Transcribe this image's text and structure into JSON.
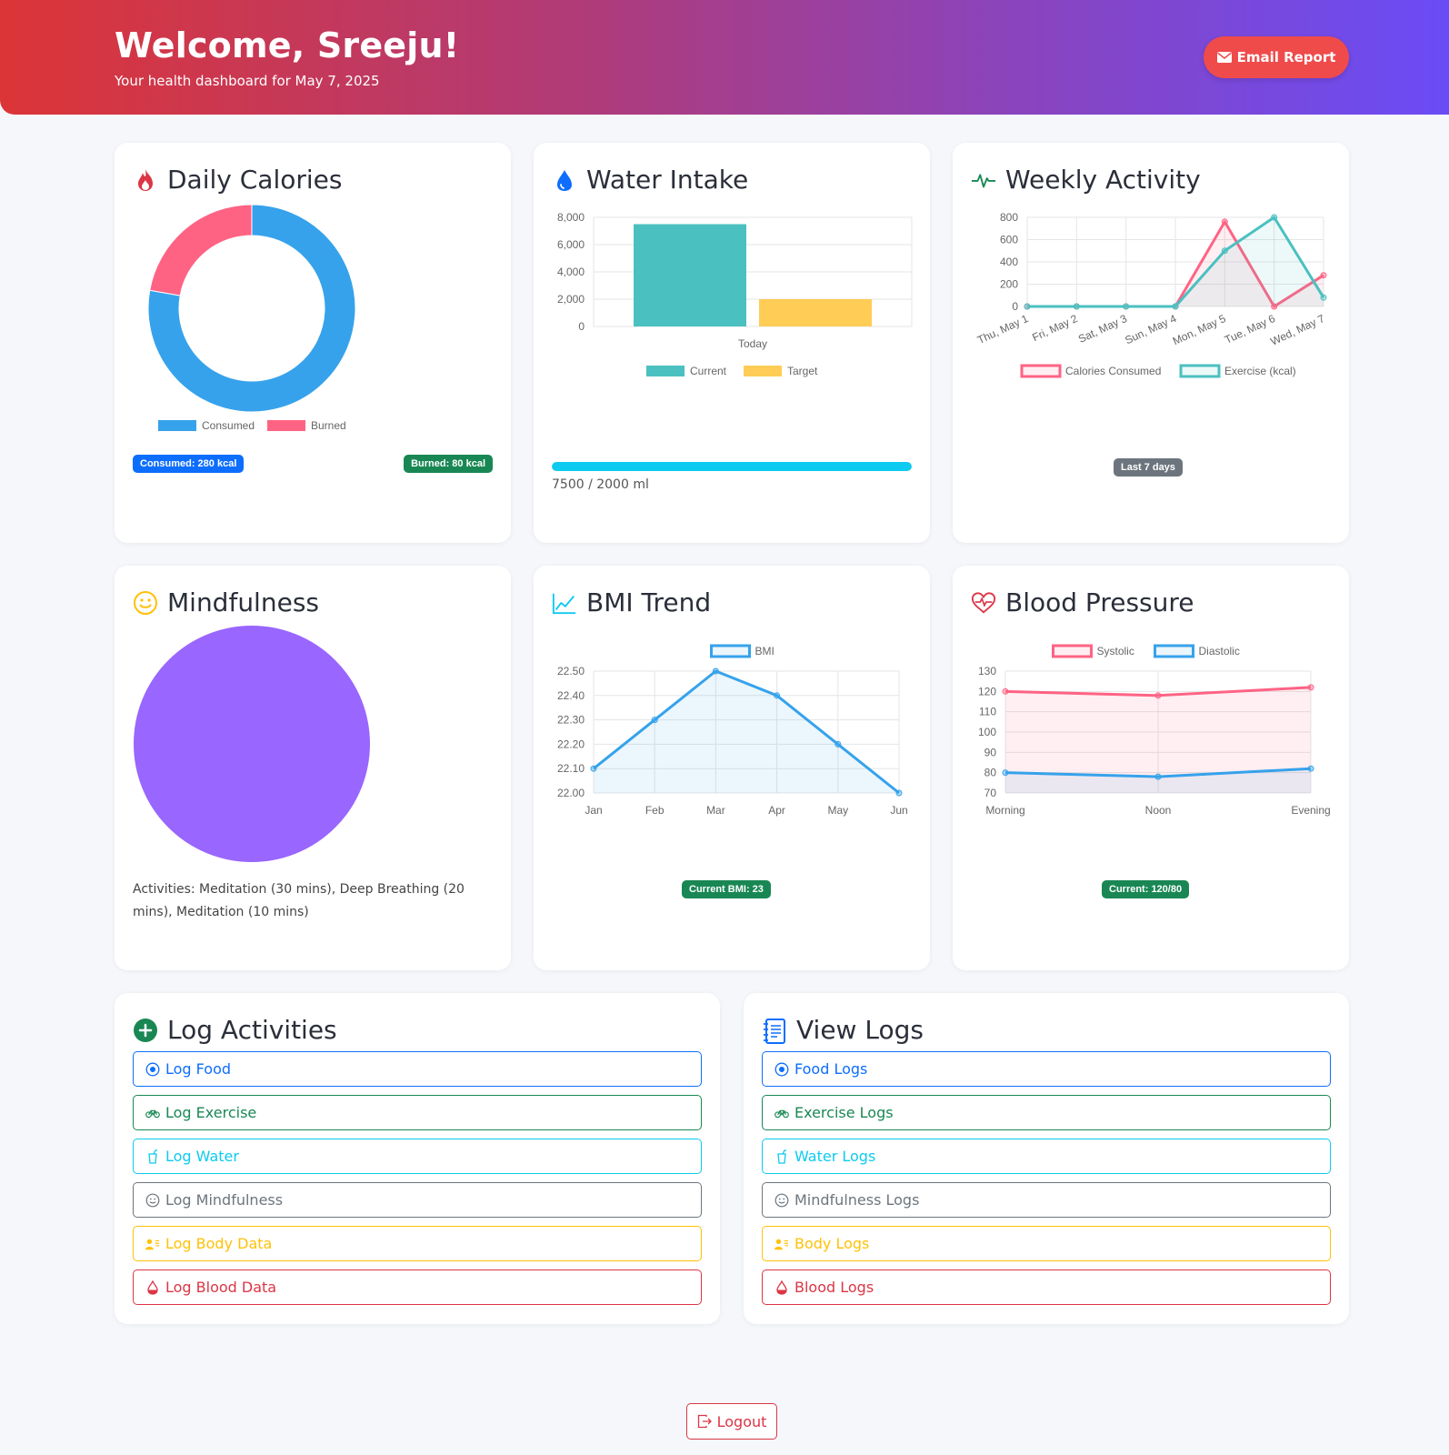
{
  "header": {
    "title": "Welcome, Sreeju!",
    "subtitle": "Your health dashboard for May 7, 2025",
    "email_label": "Email Report"
  },
  "calories": {
    "title": "Daily Calories",
    "consumed_badge": "Consumed: 280 kcal",
    "burned_badge": "Burned: 80 kcal"
  },
  "water": {
    "title": "Water Intake",
    "progress_text": "7500 / 2000 ml",
    "progress_fraction": 1.0
  },
  "activity": {
    "title": "Weekly Activity",
    "badge": "Last 7 days"
  },
  "mindfulness": {
    "title": "Mindfulness",
    "activities_text": "Activities: Meditation (30 mins), Deep Breathing (20 mins), Meditation (10 mins)"
  },
  "bmi": {
    "title": "BMI Trend",
    "badge": "Current BMI: 23"
  },
  "bp": {
    "title": "Blood Pressure",
    "badge": "Current: 120/80"
  },
  "log_activities": {
    "title": "Log Activities",
    "buttons": [
      "Log Food",
      "Log Exercise",
      "Log Water",
      "Log Mindfulness",
      "Log Body Data",
      "Log Blood Data"
    ]
  },
  "view_logs": {
    "title": "View Logs",
    "buttons": [
      "Food Logs",
      "Exercise Logs",
      "Water Logs",
      "Mindfulness Logs",
      "Body Logs",
      "Blood Logs"
    ]
  },
  "logout_label": "Logout",
  "chart_data": [
    {
      "type": "pie",
      "variant": "doughnut",
      "categories": [
        "Consumed",
        "Burned"
      ],
      "values": [
        280,
        80
      ],
      "colors": [
        "#36a2eb",
        "#ff6384"
      ],
      "legend": "bottom"
    },
    {
      "type": "bar",
      "categories": [
        "Today"
      ],
      "series": [
        {
          "name": "Current",
          "values": [
            7500
          ],
          "color": "#4bc0c0"
        },
        {
          "name": "Target",
          "values": [
            2000
          ],
          "color": "#ffcd56"
        }
      ],
      "ylim": [
        0,
        8000
      ],
      "yticks": [
        "0",
        "2,000",
        "4,000",
        "6,000",
        "8,000"
      ],
      "legend": "bottom",
      "grid": true
    },
    {
      "type": "line",
      "categories": [
        "Thu, May 1",
        "Fri, May 2",
        "Sat, May 3",
        "Sun, May 4",
        "Mon, May 5",
        "Tue, May 6",
        "Wed, May 7"
      ],
      "series": [
        {
          "name": "Calories Consumed",
          "values": [
            0,
            0,
            0,
            0,
            760,
            0,
            280
          ],
          "color": "#ff6384"
        },
        {
          "name": "Exercise (kcal)",
          "values": [
            0,
            0,
            0,
            0,
            500,
            800,
            80
          ],
          "color": "#4bc0c0"
        }
      ],
      "ylim": [
        0,
        800
      ],
      "yticks": [
        "0",
        "200",
        "400",
        "600",
        "800"
      ],
      "legend": "bottom",
      "grid": true
    },
    {
      "type": "pie",
      "categories": [
        ""
      ],
      "values": [
        1
      ],
      "colors": [
        "#9966ff"
      ]
    },
    {
      "type": "area",
      "categories": [
        "Jan",
        "Feb",
        "Mar",
        "Apr",
        "May",
        "Jun"
      ],
      "series": [
        {
          "name": "BMI",
          "values": [
            22.1,
            22.3,
            22.5,
            22.4,
            22.2,
            22.0
          ],
          "color": "#36a2eb"
        }
      ],
      "ylim": [
        22.0,
        22.5
      ],
      "yticks": [
        "22.00",
        "22.10",
        "22.20",
        "22.30",
        "22.40",
        "22.50"
      ],
      "legend": "top",
      "grid": true
    },
    {
      "type": "area",
      "categories": [
        "Morning",
        "Noon",
        "Evening"
      ],
      "series": [
        {
          "name": "Systolic",
          "values": [
            120,
            118,
            122
          ],
          "color": "#ff6384"
        },
        {
          "name": "Diastolic",
          "values": [
            80,
            78,
            82
          ],
          "color": "#36a2eb"
        }
      ],
      "ylim": [
        70,
        130
      ],
      "yticks": [
        "70",
        "80",
        "90",
        "100",
        "110",
        "120",
        "130"
      ],
      "legend": "top",
      "grid": true
    }
  ]
}
